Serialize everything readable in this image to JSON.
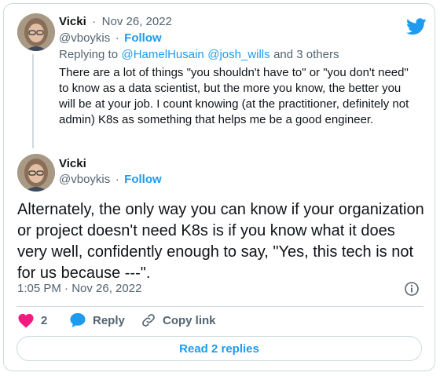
{
  "reply_tweet": {
    "author_name": "Vicki",
    "separator": "·",
    "date": "Nov 26, 2022",
    "handle": "@vboykis",
    "follow_label": "Follow",
    "replying_prefix": "Replying to",
    "replying_to_1": "@HamelHusain",
    "replying_to_2": "@josh_wills",
    "replying_suffix": "and 3 others",
    "text": "There are a lot of things \"you shouldn't have to\" or \"you don't need\" to know as a data scientist, but the more you know, the better you will be at your job. I count knowing (at the practitioner, definitely not admin) K8s as something that helps me be a good engineer."
  },
  "main_tweet": {
    "author_name": "Vicki",
    "handle": "@vboykis",
    "follow_label": "Follow",
    "text": "Alternately, the only way you can know if your organization or project doesn't need K8s is if you know what it does very well, confidently enough to say, \"Yes, this tech is not for us because ---\".",
    "timestamp": "1:05 PM · Nov 26, 2022"
  },
  "actions": {
    "like_count": "2",
    "reply_label": "Reply",
    "copy_link_label": "Copy link"
  },
  "read_replies_label": "Read 2 replies",
  "icons": {
    "brand": "twitter-bird-icon",
    "like": "heart-icon",
    "reply": "speech-bubble-icon",
    "copy": "link-icon",
    "info": "info-icon"
  },
  "colors": {
    "accent": "#1d9bf0",
    "like": "#f91880",
    "text": "#0f1419",
    "muted": "#536471",
    "border": "#cfd9de"
  }
}
